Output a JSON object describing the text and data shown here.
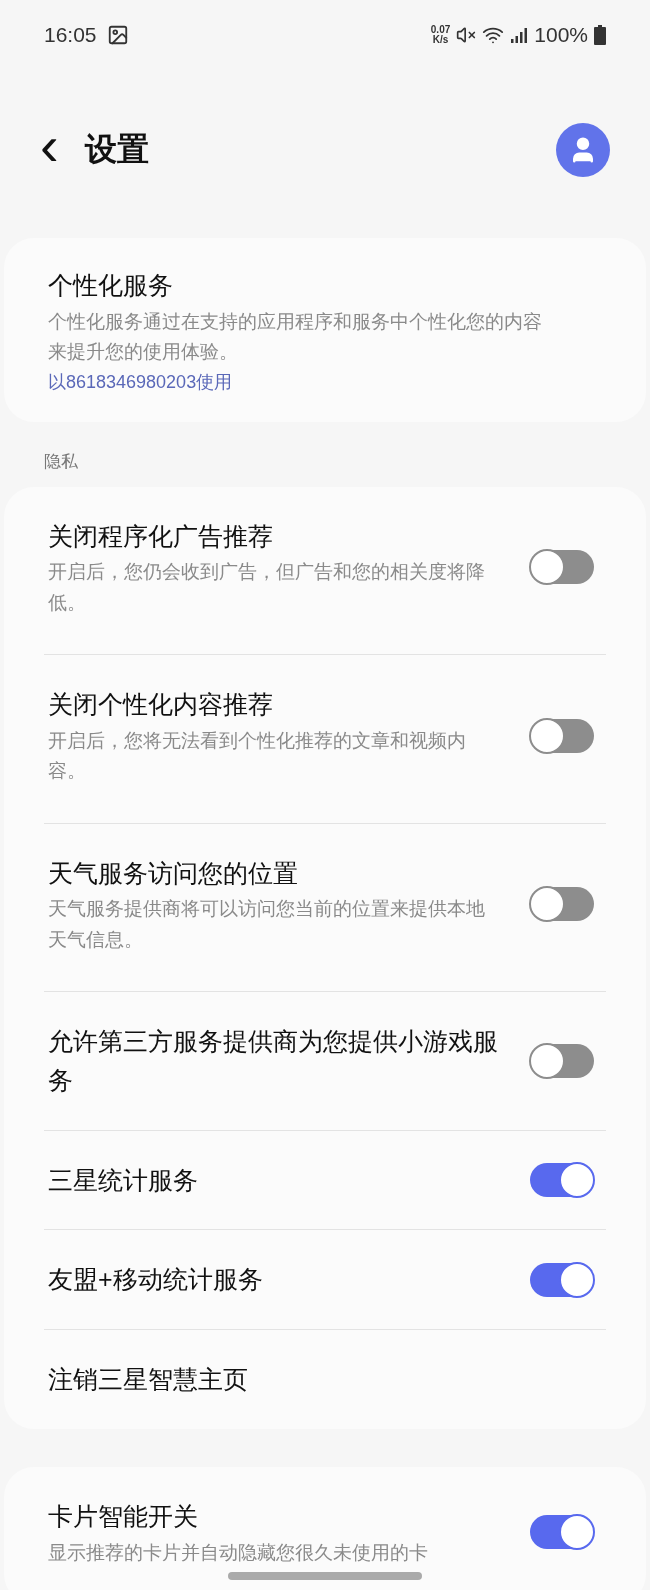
{
  "status_bar": {
    "time": "16:05",
    "speed_value": "0.07",
    "speed_unit": "K/s",
    "battery": "100%"
  },
  "header": {
    "back": "‹",
    "title": "设置"
  },
  "personal_card": {
    "title": "个性化服务",
    "description": "个性化服务通过在支持的应用程序和服务中个性化您的内容来提升您的使用体验。",
    "link": "以8618346980203使用"
  },
  "privacy": {
    "section_title": "隐私",
    "items": [
      {
        "kind": "toggle",
        "title": "关闭程序化广告推荐",
        "description": "开启后，您仍会收到广告，但广告和您的相关度将降低。",
        "on": false
      },
      {
        "kind": "toggle",
        "title": "关闭个性化内容推荐",
        "description": "开启后，您将无法看到个性化推荐的文章和视频内容。",
        "on": false
      },
      {
        "kind": "toggle",
        "title": "天气服务访问您的位置",
        "description": "天气服务提供商将可以访问您当前的位置来提供本地天气信息。",
        "on": false
      },
      {
        "kind": "toggle",
        "title": "允许第三方服务提供商为您提供小游戏服务",
        "on": false
      },
      {
        "kind": "toggle",
        "title": "三星统计服务",
        "on": true
      },
      {
        "kind": "toggle",
        "title": "友盟+移动统计服务",
        "on": true
      },
      {
        "kind": "link",
        "title": "注销三星智慧主页"
      }
    ]
  },
  "bottom_card": {
    "items": [
      {
        "kind": "toggle",
        "title": "卡片智能开关",
        "description": "显示推荐的卡片并自动隐藏您很久未使用的卡",
        "on": true
      }
    ]
  }
}
